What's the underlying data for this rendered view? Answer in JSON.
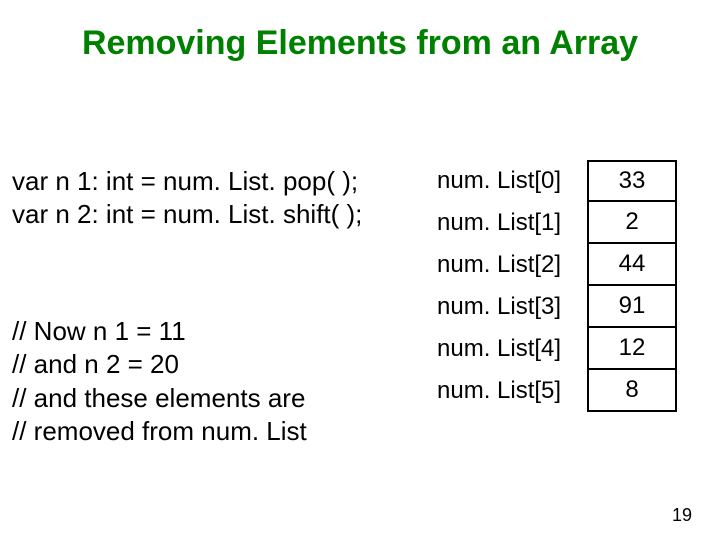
{
  "title": "Removing Elements from an Array",
  "code": {
    "line1": "var n 1: int = num. List. pop( );",
    "line2": "var n 2: int = num. List. shift( );"
  },
  "comments": {
    "line1": "// Now n 1 = 11",
    "line2": "// and n 2 = 20",
    "line3": "// and these elements are",
    "line4": "// removed from num. List"
  },
  "array": {
    "rows": [
      {
        "label": "num. List[0]",
        "value": "33"
      },
      {
        "label": "num. List[1]",
        "value": "2"
      },
      {
        "label": "num. List[2]",
        "value": "44"
      },
      {
        "label": "num. List[3]",
        "value": "91"
      },
      {
        "label": "num. List[4]",
        "value": "12"
      },
      {
        "label": "num. List[5]",
        "value": "8"
      }
    ]
  },
  "page_number": "19"
}
